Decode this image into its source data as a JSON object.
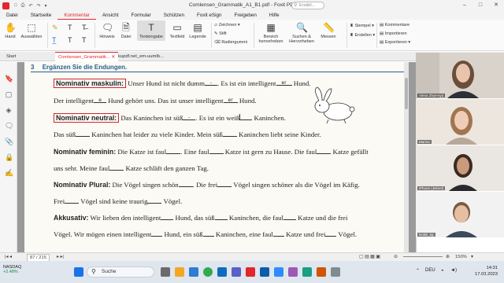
{
  "app": {
    "window_title": "Comlensen_Grammatik_A1_B1.pdf - Foxit PDF Reader",
    "search_placeholder": "Erzähl...",
    "quick_access": [
      "□",
      "⎙",
      "↶",
      "↷",
      "▾"
    ]
  },
  "menu": [
    "Datei",
    "Startseite",
    "Kommentar",
    "Ansicht",
    "Formular",
    "Schützen",
    "Foxit eSign",
    "Freigeben",
    "Hilfe"
  ],
  "menu_active_index": 2,
  "ribbon": {
    "hand": "Hand",
    "select": "Auswählen",
    "hinweis": "Hinweis",
    "datei": "Datei",
    "texteingabe": "Texteingabe",
    "textfeld": "Textfeld",
    "legende": "Legende",
    "zeichnen": "Zeichnen",
    "stift": "Stift",
    "radiergummi": "Radiergummi",
    "bereich": "Bereich hervorheben",
    "suchen": "Suchen & Hervorheben",
    "messen": "Messen",
    "stempel": "Stempel",
    "erstellen": "Erstellen",
    "kommentare": "Kommentare",
    "importieren": "Importieren",
    "exportieren": "Exportieren"
  },
  "tabs": {
    "start": "Start",
    "doc1": "Comlensen_Grammatik...",
    "doc2": "kupdf.net_em-uumlb..."
  },
  "document": {
    "section_number": "3",
    "heading": "Ergänzen Sie die Endungen.",
    "lines": [
      {
        "label": "Nominativ maskulin:",
        "boxed": true,
        "t1": " Unser Hund ist nicht dumm",
        "h1": "-",
        "t2": ". Es ist ein intelligent",
        "h2": "er",
        "t3": " Hund."
      },
      {
        "t1": "Der intelligent",
        "h1": "e",
        "t2": " Hund gehört uns. Das ist unser intelligent",
        "h2": "er",
        "t3": " Hund."
      },
      {
        "label": "Nominativ neutral:",
        "boxed": true,
        "t1": " Das Kaninchen ist süß",
        "h1": "-",
        "t2": ". Es ist ein weiß",
        "h2": "",
        "t3": " Kaninchen."
      },
      {
        "t1": "Das süß",
        "t2": " Kaninchen hat leider zu viele Kinder. Mein süß",
        "t3": " Kaninchen liebt seine Kinder."
      },
      {
        "label": "Nominativ feminin:",
        "t1": " Die Katze ist faul",
        "t2": ". Eine faul",
        "t3": " Katze ist gern zu Hause. Die faul",
        "t4": " Katze gefällt"
      },
      {
        "t1": "uns sehr. Meine faul",
        "t2": " Katze schläft den ganzen Tag."
      },
      {
        "label": "Nominativ Plural:",
        "t1": " Die Vögel singen schön",
        "t2": ". Die frei",
        "t3": " Vögel singen schöner als die Vögel im Käfig."
      },
      {
        "t1": "Frei",
        "t2": " Vögel sind keine traurig",
        "t3": " Vögel."
      },
      {
        "label": "Akkusativ:",
        "t1": " Wir lieben den intelligent",
        "t2": " Hund, das süß",
        "t3": " Kaninchen, die faul",
        "t4": " Katze und die frei"
      },
      {
        "t1": "Vögel. Wir mögen einen intelligent",
        "t2": " Hund, ein süß",
        "t3": " Kaninchen, eine faul",
        "t4": " Katze und frei",
        "t5": " Vögel."
      }
    ]
  },
  "participants": [
    {
      "name": "Alena Zhylenya"
    },
    {
      "name": "Marina"
    },
    {
      "name": "iPhone (Jeknel)"
    },
    {
      "name": "Nobili_kg"
    }
  ],
  "status": {
    "page": "87 / 215",
    "zoom": "150%"
  },
  "taskbar": {
    "stock_name": "NASDAQ",
    "stock_change": "+2.48%",
    "search": "Suche",
    "lang": "DEU",
    "time": "14:31",
    "date": "17.03.2023"
  },
  "colors": {
    "accent": "#e3262a",
    "heading_blue": "#2a5d8f",
    "box_red": "#d0262b"
  }
}
